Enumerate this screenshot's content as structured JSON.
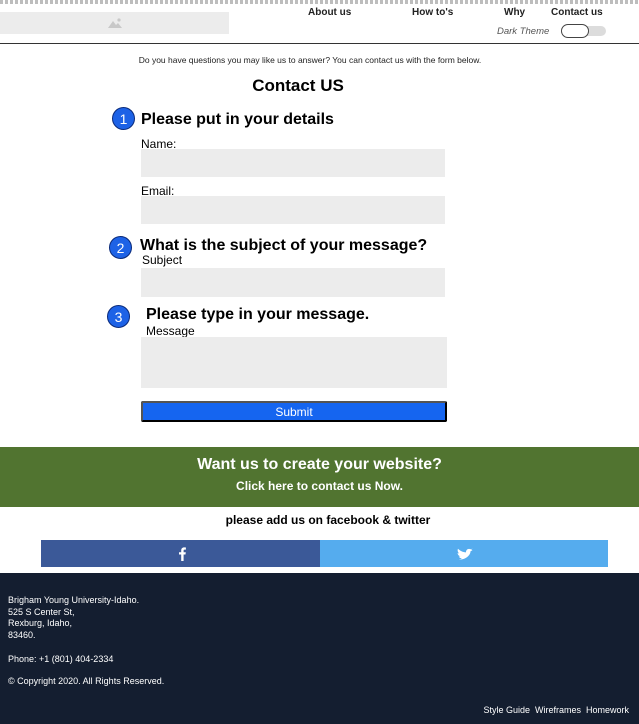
{
  "header": {
    "nav": [
      "About us",
      "How to's",
      "Why",
      "Contact us"
    ],
    "theme_label": "Dark Theme"
  },
  "intro": "Do you have questions you may like us to answer? You can contact us with the form below.",
  "title": "Contact US",
  "sections": [
    {
      "number": "1",
      "heading": "Please put in your details"
    },
    {
      "number": "2",
      "heading": "What is the subject of your message?"
    },
    {
      "number": "3",
      "heading": "Please type in your message."
    }
  ],
  "fields": {
    "name_label": "Name:",
    "email_label": "Email:",
    "subject_label": "Subject",
    "message_label": "Message"
  },
  "submit_label": "Submit",
  "cta": {
    "heading": "Want us to create your website?",
    "link": "Click here to contact us Now."
  },
  "social_text": "please add us on facebook & twitter",
  "footer": {
    "address": [
      "Brigham Young University-Idaho.",
      "525 S Center St,",
      "Rexburg, Idaho,",
      "83460."
    ],
    "phone": "Phone: +1 (801) 404-2334",
    "copyright": "© Copyright 2020. All Rights Reserved.",
    "links": [
      "Style Guide",
      "Wireframes",
      "Homework"
    ]
  }
}
